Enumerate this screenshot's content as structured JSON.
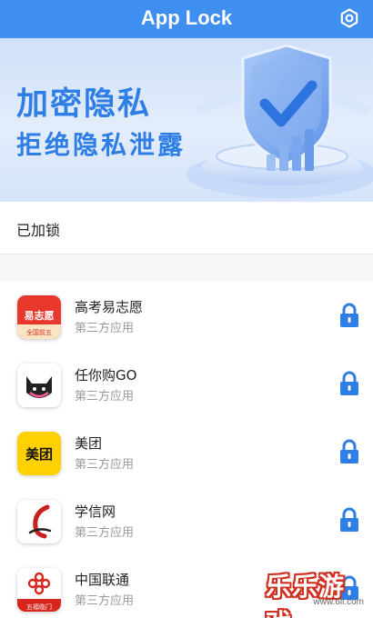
{
  "header": {
    "title": "App Lock",
    "settings_icon": "settings-gear-icon",
    "background": "#3f8ff0"
  },
  "banner": {
    "title": "加密隐私",
    "subtitle": "拒绝隐私泄露",
    "accent": "#2f7ee6"
  },
  "section": {
    "title": "已加锁"
  },
  "apps": [
    {
      "name": "高考易志愿",
      "subtitle": "第三方应用",
      "icon_text": "易志愿",
      "icon_caption": "全国前五",
      "locked": true
    },
    {
      "name": "任你购GO",
      "subtitle": "第三方应用",
      "icon_text": "",
      "locked": true
    },
    {
      "name": "美团",
      "subtitle": "第三方应用",
      "icon_text": "美团",
      "locked": true
    },
    {
      "name": "学信网",
      "subtitle": "第三方应用",
      "icon_text": "",
      "locked": true
    },
    {
      "name": "中国联通",
      "subtitle": "第三方应用",
      "icon_text": "五福临门",
      "locked": true
    }
  ],
  "watermark": {
    "text": "乐乐游戏",
    "url": "www.6ll.com"
  },
  "colors": {
    "lock": "#2f7ee6",
    "subtitle": "#999999"
  }
}
